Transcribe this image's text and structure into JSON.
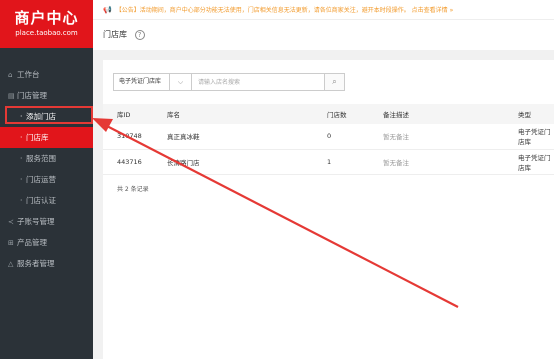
{
  "logo": {
    "title": "商户中心",
    "subtitle": "place.taobao.com"
  },
  "notice": {
    "text": "【公告】活动期间，商户中心部分功能无法使用，门店相关信息无法更新，请各位商家关注，避开本时段操作。",
    "link": "点击查看详情 »"
  },
  "page": {
    "title": "门店库",
    "help": "?"
  },
  "sidebar": {
    "workbench": "工作台",
    "store_mgmt": "门店管理",
    "subs": [
      "添加门店",
      "门店库",
      "服务范围",
      "门店运营",
      "门店认证"
    ],
    "account_mgmt": "子账号管理",
    "product_mgmt": "产品管理",
    "servicer_mgmt": "服务者管理"
  },
  "filter": {
    "select_value": "电子凭证门店库",
    "search_placeholder": "请输入店名搜索"
  },
  "table": {
    "headers": [
      "库ID",
      "库名",
      "门店数",
      "备注描述",
      "类型"
    ],
    "rows": [
      [
        "310748",
        "真正真冰鞋",
        "0",
        "暂无备注",
        "电子凭证门店库"
      ],
      [
        "443716",
        "长清路门店",
        "1",
        "暂无备注",
        "电子凭证门店库"
      ]
    ],
    "total": "共 2 条记录"
  },
  "annotation_color": "#e53935",
  "accent": "#e1151b"
}
